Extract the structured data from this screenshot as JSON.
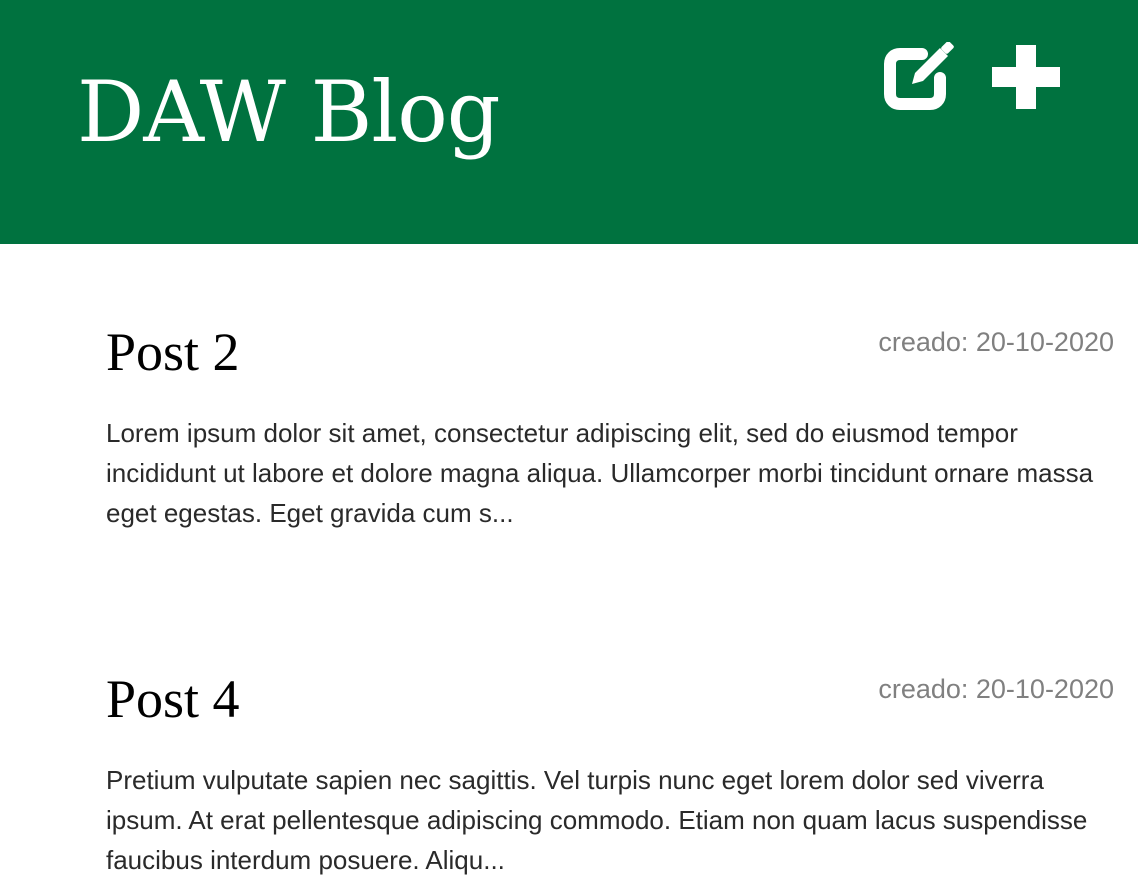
{
  "header": {
    "brand": "DAW Blog",
    "background": "#00723f",
    "actions": [
      {
        "icon": "edit-icon"
      },
      {
        "icon": "plus-icon"
      }
    ]
  },
  "posts": [
    {
      "title": "Post 2",
      "date": "creado: 20-10-2020",
      "excerpt": "Lorem ipsum dolor sit amet, consectetur adipiscing elit, sed do eiusmod tempor incididunt ut labore et dolore magna aliqua. Ullamcorper morbi tincidunt ornare massa eget egestas. Eget gravida cum s..."
    },
    {
      "title": "Post 4",
      "date": "creado: 20-10-2020",
      "excerpt": "Pretium vulputate sapien nec sagittis. Vel turpis nunc eget lorem dolor sed viverra ipsum. At erat pellentesque adipiscing commodo. Etiam non quam lacus suspendisse faucibus interdum posuere. Aliqu..."
    }
  ]
}
